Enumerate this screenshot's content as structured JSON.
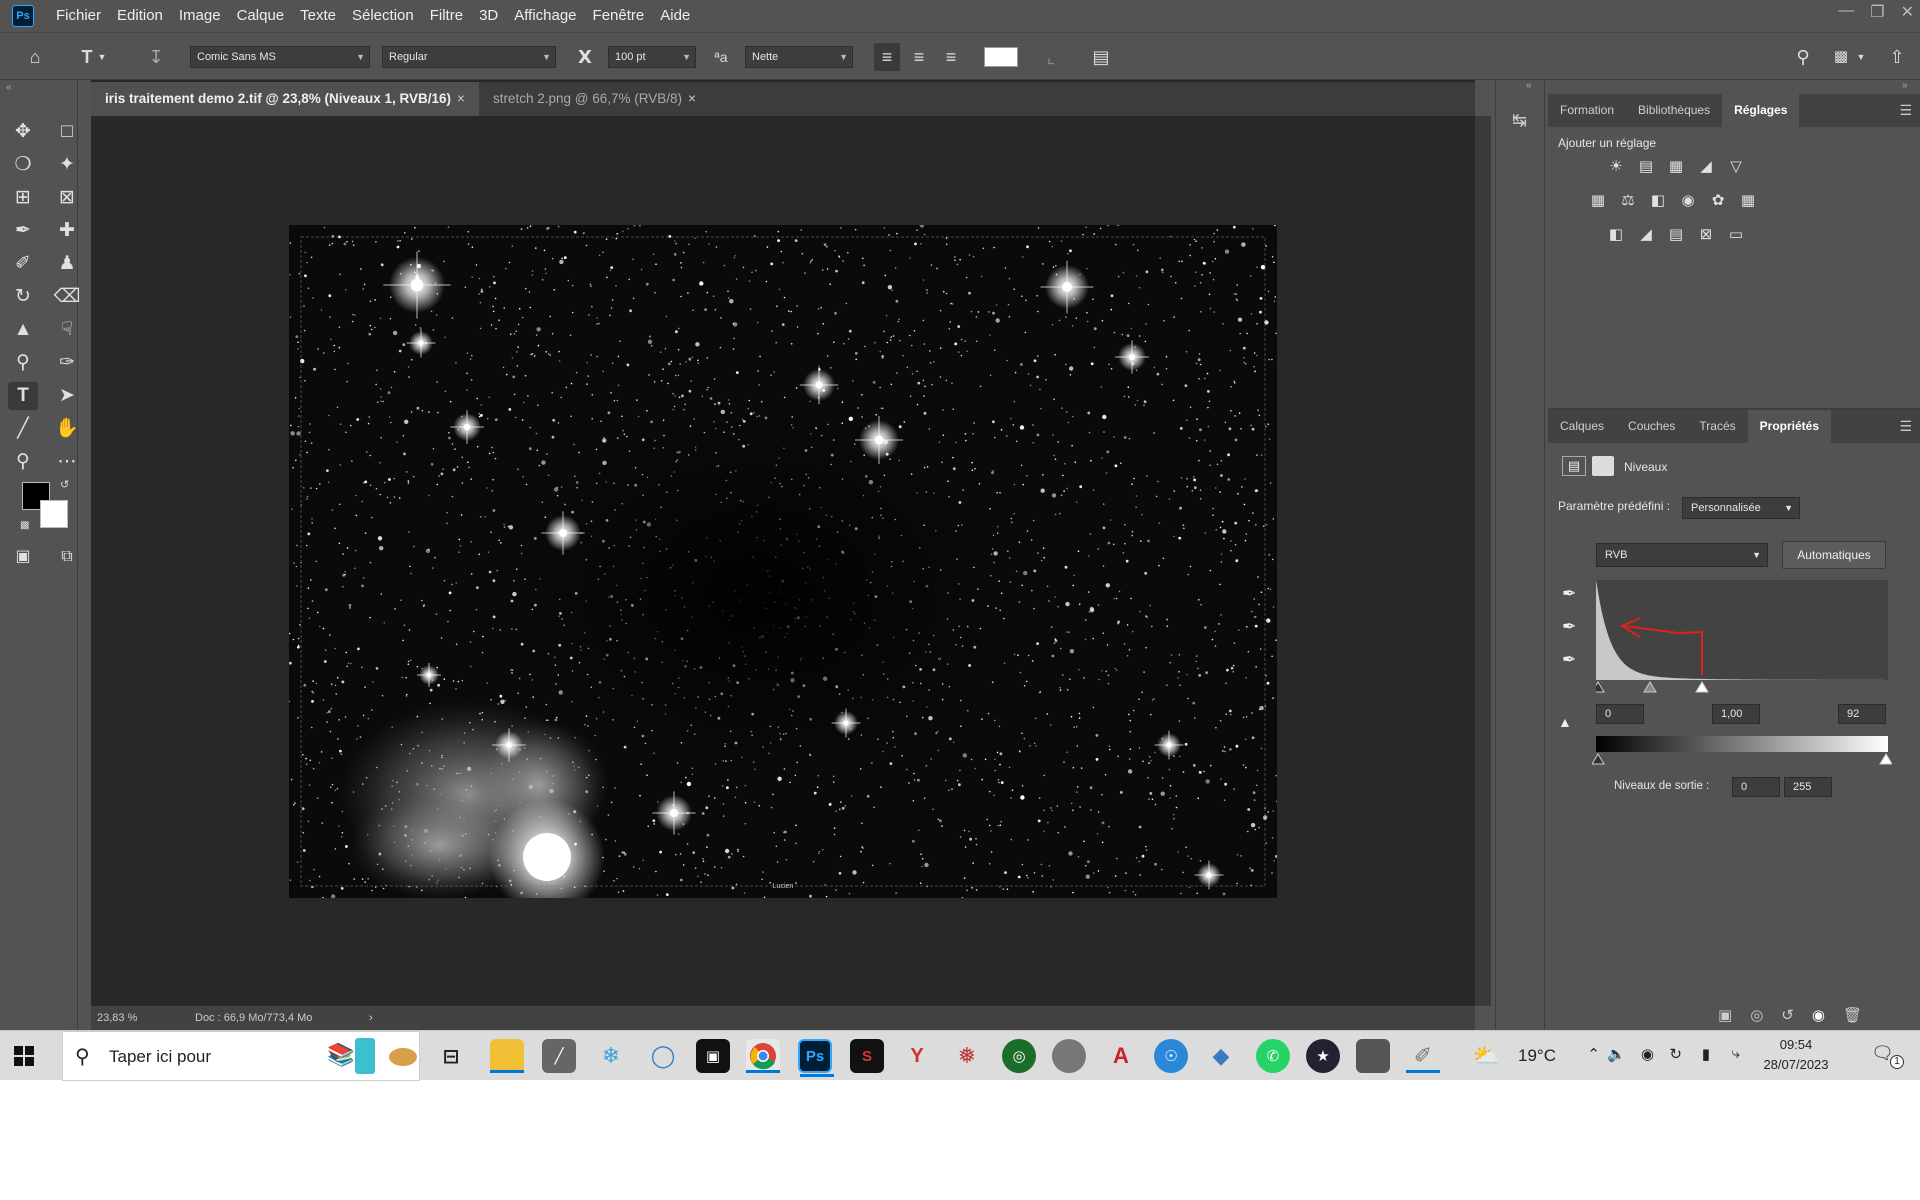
{
  "menubar": {
    "logo": "Ps",
    "items": [
      "Fichier",
      "Edition",
      "Image",
      "Calque",
      "Texte",
      "Sélection",
      "Filtre",
      "3D",
      "Affichage",
      "Fenêtre",
      "Aide"
    ]
  },
  "options": {
    "font_family": "Comic Sans MS",
    "font_style": "Regular",
    "font_size": "100 pt",
    "antialias": "Nette",
    "text_color": "#ffffff"
  },
  "tabs": [
    {
      "label": "iris traitement demo 2.tif @ 23,8% (Niveaux 1, RVB/16)",
      "close": "×",
      "active": true
    },
    {
      "label": "stretch 2.png @ 66,7% (RVB/8)",
      "close": "×",
      "active": false
    }
  ],
  "canvas": {
    "watermark": "Lucien"
  },
  "status": {
    "zoom": "23,83 %",
    "doc": "Doc : 66,9 Mo/773,4 Mo",
    "arrow": "›"
  },
  "panels": {
    "top_tabs": [
      "Formation",
      "Bibliothèques",
      "Réglages"
    ],
    "top_active": "Réglages",
    "add_adjustment": "Ajouter un réglage",
    "bottom_tabs": [
      "Calques",
      "Couches",
      "Tracés",
      "Propriétés"
    ],
    "bottom_active": "Propriétés"
  },
  "properties": {
    "title": "Niveaux",
    "preset_label": "Paramètre prédéfini :",
    "preset_value": "Personnalisée",
    "channel": "RVB",
    "auto_button": "Automatiques",
    "input_black": "0",
    "input_gamma": "1,00",
    "input_white": "92",
    "output_label": "Niveaux de sortie :",
    "output_black": "0",
    "output_white": "255"
  },
  "taskbar": {
    "search_placeholder": "Taper ici pour",
    "temperature": "19°C",
    "time": "09:54",
    "date": "28/07/2023",
    "notifications": "1"
  },
  "colors": {
    "accent": "#31a8ff",
    "annotation_arrow": "#e0201f"
  }
}
